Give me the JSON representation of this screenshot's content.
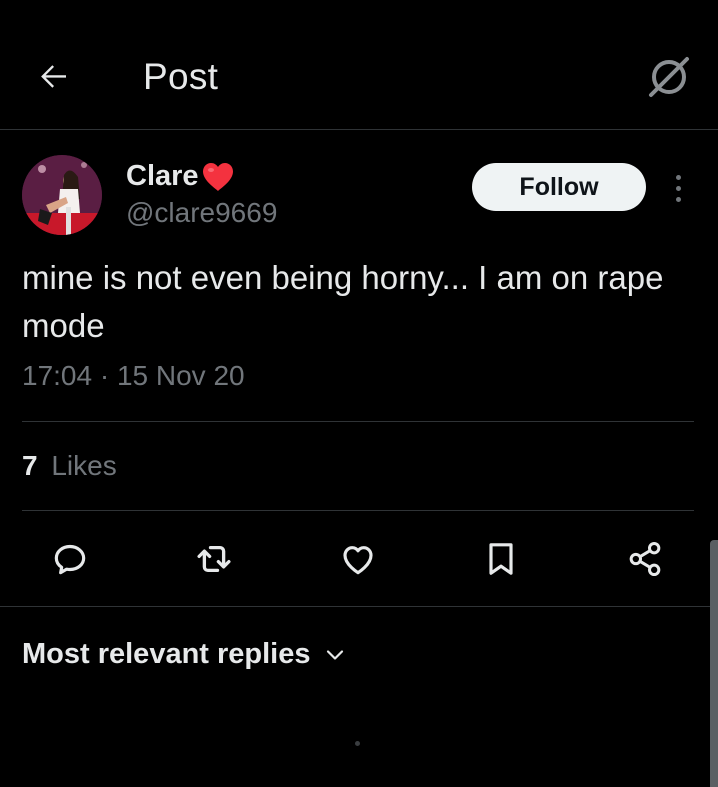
{
  "header": {
    "title": "Post",
    "back_icon": "arrow-left-icon",
    "grok_icon": "grok-icon"
  },
  "post": {
    "author": {
      "display_name": "Clare",
      "name_emoji": "red-heart-emoji",
      "handle": "@clare9669"
    },
    "follow_label": "Follow",
    "text": "mine is not even being horny... I am on rape mode",
    "timestamp": "17:04 · 15 Nov 20",
    "likes": {
      "count": "7",
      "label": "Likes"
    }
  },
  "actions": [
    "reply-icon",
    "repost-icon",
    "like-icon",
    "bookmark-icon",
    "share-icon"
  ],
  "replies": {
    "sort_label": "Most relevant replies"
  },
  "colors": {
    "background": "#000000",
    "text_primary": "#e7e9ea",
    "text_secondary": "#71767b",
    "divider": "#2f3336",
    "follow_bg": "#eff3f4",
    "heart": "#f4323f"
  }
}
